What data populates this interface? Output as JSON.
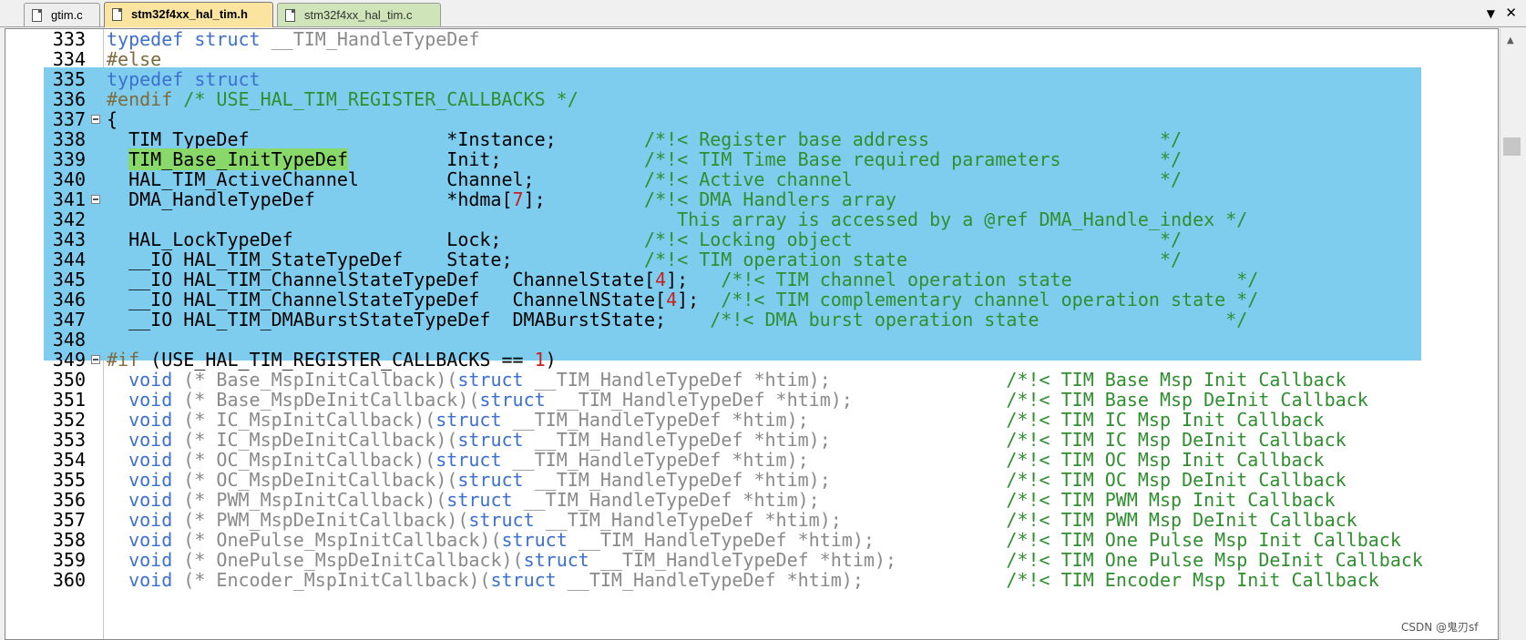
{
  "tabs": [
    {
      "label": "gtim.c",
      "active": false
    },
    {
      "label": "stm32f4xx_hal_tim.h",
      "active": true
    },
    {
      "label": "stm32f4xx_hal_tim.c",
      "active": false
    }
  ],
  "icons": {
    "tab_menu": "chevron-down-icon",
    "tab_close": "close-icon",
    "scroll_up": "scroll-up-icon"
  },
  "colors": {
    "selection": "#7ecdee",
    "word_highlight": "#88d86a",
    "keyword": "#3b6fd0",
    "comment": "#2f8f2f",
    "active_tab": "#fbe4a0"
  },
  "lines": [
    {
      "num": "333",
      "fold": false,
      "spans": [
        {
          "t": "typedef",
          "c": "kw"
        },
        {
          "t": " "
        },
        {
          "t": "struct",
          "c": "kw"
        },
        {
          "t": " __TIM_HandleTypeDef",
          "c": "grey"
        }
      ]
    },
    {
      "num": "334",
      "fold": false,
      "spans": [
        {
          "t": "#else",
          "c": "pp"
        }
      ]
    },
    {
      "num": "335",
      "fold": false,
      "spans": [
        {
          "t": "typedef",
          "c": "kw"
        },
        {
          "t": " "
        },
        {
          "t": "struct",
          "c": "kw"
        }
      ]
    },
    {
      "num": "336",
      "fold": false,
      "spans": [
        {
          "t": "#endif",
          "c": "pp"
        },
        {
          "t": " /* USE_HAL_TIM_REGISTER_CALLBACKS */",
          "c": "cm"
        }
      ]
    },
    {
      "num": "337",
      "fold": true,
      "spans": [
        {
          "t": "{"
        }
      ]
    },
    {
      "num": "338",
      "fold": false,
      "spans": [
        {
          "t": "  TIM_TypeDef                  *Instance;        "
        },
        {
          "t": "/*!< Register base address                     */",
          "c": "cm"
        }
      ]
    },
    {
      "num": "339",
      "fold": false,
      "spans": [
        {
          "t": "  "
        },
        {
          "t": "TIM_Base_InitTypeDef",
          "c": "hl"
        },
        {
          "t": "         Init;             "
        },
        {
          "t": "/*!< TIM Time Base required parameters         */",
          "c": "cm"
        }
      ]
    },
    {
      "num": "340",
      "fold": false,
      "spans": [
        {
          "t": "  HAL_TIM_ActiveChannel        Channel;          "
        },
        {
          "t": "/*!< Active channel                            */",
          "c": "cm"
        }
      ]
    },
    {
      "num": "341",
      "fold": true,
      "spans": [
        {
          "t": "  DMA_HandleTypeDef            *hdma["
        },
        {
          "t": "7",
          "c": "num"
        },
        {
          "t": "];         "
        },
        {
          "t": "/*!< DMA Handlers array",
          "c": "cm"
        }
      ]
    },
    {
      "num": "342",
      "fold": false,
      "spans": [
        {
          "t": "                                                    "
        },
        {
          "t": "This array is accessed by a @ref DMA_Handle_index */",
          "c": "cm"
        }
      ]
    },
    {
      "num": "343",
      "fold": false,
      "spans": [
        {
          "t": "  HAL_LockTypeDef              Lock;             "
        },
        {
          "t": "/*!< Locking object                            */",
          "c": "cm"
        }
      ]
    },
    {
      "num": "344",
      "fold": false,
      "spans": [
        {
          "t": "  __IO HAL_TIM_StateTypeDef    State;            "
        },
        {
          "t": "/*!< TIM operation state                       */",
          "c": "cm"
        }
      ]
    },
    {
      "num": "345",
      "fold": false,
      "spans": [
        {
          "t": "  __IO HAL_TIM_ChannelStateTypeDef   ChannelState["
        },
        {
          "t": "4",
          "c": "num"
        },
        {
          "t": "];   "
        },
        {
          "t": "/*!< TIM channel operation state               */",
          "c": "cm"
        }
      ]
    },
    {
      "num": "346",
      "fold": false,
      "spans": [
        {
          "t": "  __IO HAL_TIM_ChannelStateTypeDef   ChannelNState["
        },
        {
          "t": "4",
          "c": "num"
        },
        {
          "t": "];  "
        },
        {
          "t": "/*!< TIM complementary channel operation state */",
          "c": "cm"
        }
      ]
    },
    {
      "num": "347",
      "fold": false,
      "spans": [
        {
          "t": "  __IO HAL_TIM_DMABurstStateTypeDef  DMABurstState;    "
        },
        {
          "t": "/*!< DMA burst operation state                 */",
          "c": "cm"
        }
      ]
    },
    {
      "num": "348",
      "fold": false,
      "spans": []
    },
    {
      "num": "349",
      "fold": true,
      "spans": [
        {
          "t": "#if",
          "c": "pp"
        },
        {
          "t": " (USE_HAL_TIM_REGISTER_CALLBACKS == "
        },
        {
          "t": "1",
          "c": "num"
        },
        {
          "t": ")"
        }
      ]
    },
    {
      "num": "350",
      "fold": false,
      "spans": [
        {
          "t": "  "
        },
        {
          "t": "void",
          "c": "kw"
        },
        {
          "t": " (* Base_MspInitCallback)(",
          "c": "grey"
        },
        {
          "t": "struct",
          "c": "kw"
        },
        {
          "t": " __TIM_HandleTypeDef *htim);",
          "c": "grey"
        },
        {
          "t": "                /*!< TIM Base Msp Init Callback",
          "c": "cm"
        }
      ]
    },
    {
      "num": "351",
      "fold": false,
      "spans": [
        {
          "t": "  "
        },
        {
          "t": "void",
          "c": "kw"
        },
        {
          "t": " (* Base_MspDeInitCallback)(",
          "c": "grey"
        },
        {
          "t": "struct",
          "c": "kw"
        },
        {
          "t": " __TIM_HandleTypeDef *htim);",
          "c": "grey"
        },
        {
          "t": "              /*!< TIM Base Msp DeInit Callback",
          "c": "cm"
        }
      ]
    },
    {
      "num": "352",
      "fold": false,
      "spans": [
        {
          "t": "  "
        },
        {
          "t": "void",
          "c": "kw"
        },
        {
          "t": " (* IC_MspInitCallback)(",
          "c": "grey"
        },
        {
          "t": "struct",
          "c": "kw"
        },
        {
          "t": " __TIM_HandleTypeDef *htim);",
          "c": "grey"
        },
        {
          "t": "                  /*!< TIM IC Msp Init Callback",
          "c": "cm"
        }
      ]
    },
    {
      "num": "353",
      "fold": false,
      "spans": [
        {
          "t": "  "
        },
        {
          "t": "void",
          "c": "kw"
        },
        {
          "t": " (* IC_MspDeInitCallback)(",
          "c": "grey"
        },
        {
          "t": "struct",
          "c": "kw"
        },
        {
          "t": " __TIM_HandleTypeDef *htim);",
          "c": "grey"
        },
        {
          "t": "                /*!< TIM IC Msp DeInit Callback",
          "c": "cm"
        }
      ]
    },
    {
      "num": "354",
      "fold": false,
      "spans": [
        {
          "t": "  "
        },
        {
          "t": "void",
          "c": "kw"
        },
        {
          "t": " (* OC_MspInitCallback)(",
          "c": "grey"
        },
        {
          "t": "struct",
          "c": "kw"
        },
        {
          "t": " __TIM_HandleTypeDef *htim);",
          "c": "grey"
        },
        {
          "t": "                  /*!< TIM OC Msp Init Callback",
          "c": "cm"
        }
      ]
    },
    {
      "num": "355",
      "fold": false,
      "spans": [
        {
          "t": "  "
        },
        {
          "t": "void",
          "c": "kw"
        },
        {
          "t": " (* OC_MspDeInitCallback)(",
          "c": "grey"
        },
        {
          "t": "struct",
          "c": "kw"
        },
        {
          "t": " __TIM_HandleTypeDef *htim);",
          "c": "grey"
        },
        {
          "t": "                /*!< TIM OC Msp DeInit Callback",
          "c": "cm"
        }
      ]
    },
    {
      "num": "356",
      "fold": false,
      "spans": [
        {
          "t": "  "
        },
        {
          "t": "void",
          "c": "kw"
        },
        {
          "t": " (* PWM_MspInitCallback)(",
          "c": "grey"
        },
        {
          "t": "struct",
          "c": "kw"
        },
        {
          "t": " __TIM_HandleTypeDef *htim);",
          "c": "grey"
        },
        {
          "t": "                 /*!< TIM PWM Msp Init Callback",
          "c": "cm"
        }
      ]
    },
    {
      "num": "357",
      "fold": false,
      "spans": [
        {
          "t": "  "
        },
        {
          "t": "void",
          "c": "kw"
        },
        {
          "t": " (* PWM_MspDeInitCallback)(",
          "c": "grey"
        },
        {
          "t": "struct",
          "c": "kw"
        },
        {
          "t": " __TIM_HandleTypeDef *htim);",
          "c": "grey"
        },
        {
          "t": "               /*!< TIM PWM Msp DeInit Callback",
          "c": "cm"
        }
      ]
    },
    {
      "num": "358",
      "fold": false,
      "spans": [
        {
          "t": "  "
        },
        {
          "t": "void",
          "c": "kw"
        },
        {
          "t": " (* OnePulse_MspInitCallback)(",
          "c": "grey"
        },
        {
          "t": "struct",
          "c": "kw"
        },
        {
          "t": " __TIM_HandleTypeDef *htim);",
          "c": "grey"
        },
        {
          "t": "            /*!< TIM One Pulse Msp Init Callback",
          "c": "cm"
        }
      ]
    },
    {
      "num": "359",
      "fold": false,
      "spans": [
        {
          "t": "  "
        },
        {
          "t": "void",
          "c": "kw"
        },
        {
          "t": " (* OnePulse_MspDeInitCallback)(",
          "c": "grey"
        },
        {
          "t": "struct",
          "c": "kw"
        },
        {
          "t": " __TIM_HandleTypeDef *htim);",
          "c": "grey"
        },
        {
          "t": "          /*!< TIM One Pulse Msp DeInit Callback",
          "c": "cm"
        }
      ]
    },
    {
      "num": "360",
      "fold": false,
      "spans": [
        {
          "t": "  "
        },
        {
          "t": "void",
          "c": "kw"
        },
        {
          "t": " (* Encoder_MspInitCallback)(",
          "c": "grey"
        },
        {
          "t": "struct",
          "c": "kw"
        },
        {
          "t": " __TIM_HandleTypeDef *htim);",
          "c": "grey"
        },
        {
          "t": "             /*!< TIM Encoder Msp Init Callback",
          "c": "cm"
        }
      ]
    }
  ],
  "watermark": "CSDN @鬼刃sf"
}
